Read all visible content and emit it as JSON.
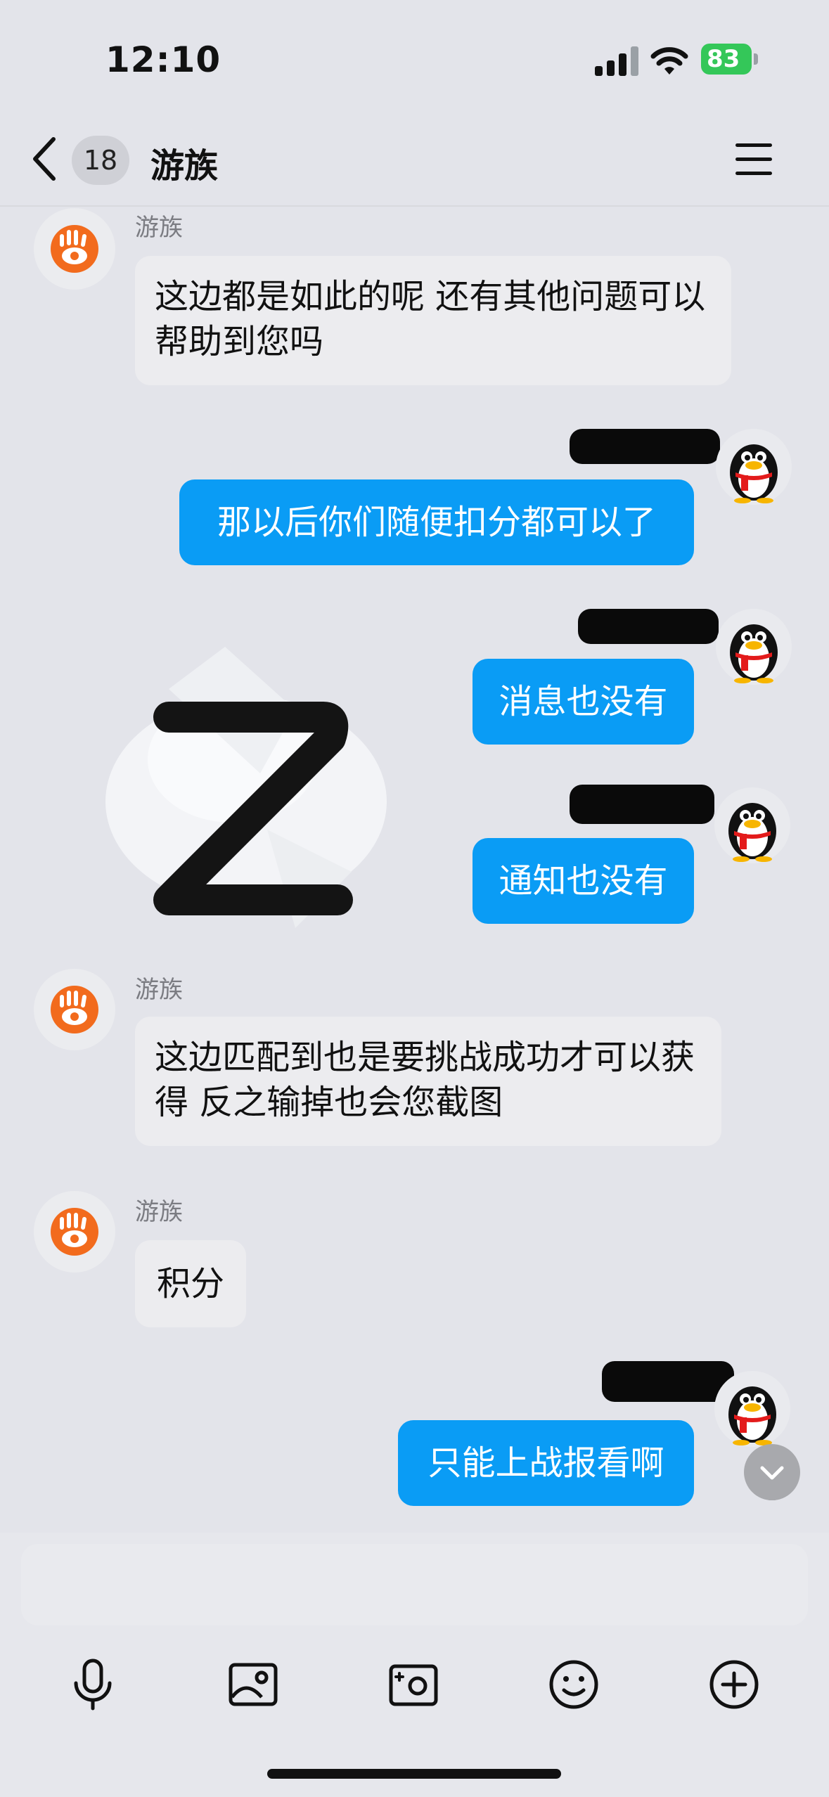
{
  "status_bar": {
    "time": "12:10",
    "battery": "83",
    "icons": [
      "signal-icon",
      "wifi-icon",
      "battery-icon"
    ]
  },
  "nav": {
    "back_icon": "chevron-left-icon",
    "unread_count": "18",
    "title": "游族",
    "menu_icon": "menu-icon"
  },
  "messages": [
    {
      "side": "in",
      "sender": "游族",
      "text": "这边都是如此的呢 还有其他问题可以帮助到您吗"
    },
    {
      "side": "out",
      "text": "那以后你们随便扣分都可以了"
    },
    {
      "side": "out",
      "text": "消息也没有"
    },
    {
      "side": "out",
      "text": "通知也没有"
    },
    {
      "side": "in",
      "sender": "游族",
      "text": "这边匹配到也是要挑战成功才可以获得 反之输掉也会您截图"
    },
    {
      "side": "in",
      "sender": "游族",
      "text": "积分"
    },
    {
      "side": "out",
      "text": "只能上战报看啊"
    }
  ],
  "toolbar": {
    "icons": [
      "microphone-icon",
      "image-icon",
      "camera-icon",
      "emoji-icon",
      "plus-icon"
    ]
  },
  "colors": {
    "accent": "#0a9cf5",
    "background": "#e3e4ea",
    "incoming_bubble": "#ececef",
    "bot_logo": "#f26b1d"
  }
}
